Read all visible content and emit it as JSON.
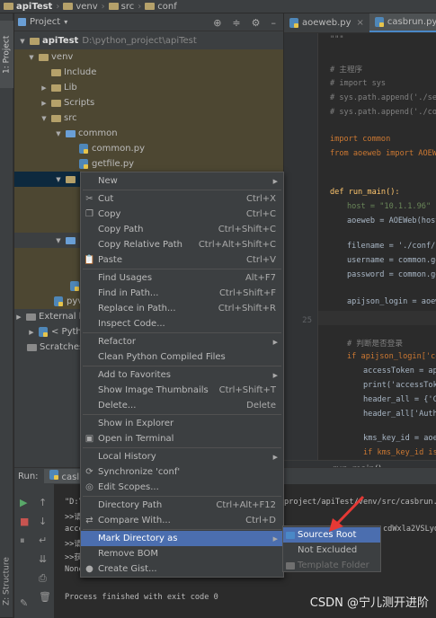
{
  "breadcrumb": [
    "apiTest",
    "venv",
    "src",
    "conf"
  ],
  "side_tabs": {
    "project": "1: Project",
    "structure": "Z: Structure"
  },
  "project_panel": {
    "title": "Project",
    "root": {
      "name": "apiTest",
      "path": "D:\\python_project\\apiTest"
    },
    "tree": [
      {
        "label": "venv",
        "level": 1,
        "expanded": true,
        "type": "folder"
      },
      {
        "label": "Include",
        "level": 2,
        "type": "folder"
      },
      {
        "label": "Lib",
        "level": 2,
        "collapsed": true,
        "type": "folder"
      },
      {
        "label": "Scripts",
        "level": 2,
        "collapsed": true,
        "type": "folder"
      },
      {
        "label": "src",
        "level": 2,
        "expanded": true,
        "type": "folder"
      },
      {
        "label": "common",
        "level": 3,
        "expanded": true,
        "type": "folder-blue"
      },
      {
        "label": "common.py",
        "level": 4,
        "type": "py"
      },
      {
        "label": "getfile.py",
        "level": 4,
        "type": "py"
      }
    ],
    "partial_rows": [
      "pyv",
      "External l",
      "< Pyth",
      "Scratches"
    ]
  },
  "editor": {
    "tabs": [
      "aoeweb.py",
      "casbrun.py"
    ],
    "line_numbers": [
      "25"
    ],
    "lines": [
      {
        "t": "\"\"\"",
        "c": "st"
      },
      {
        "t": "# 主程序",
        "c": "cm"
      },
      {
        "t": "# import sys",
        "c": "cm"
      },
      {
        "t": "# sys.path.append('./serv",
        "c": "cm"
      },
      {
        "t": "# sys.path.append('./com",
        "c": "cm"
      },
      {
        "t": "import common",
        "c": "kw"
      },
      {
        "t": "from aoeweb import AOEWeb",
        "c": "kw"
      },
      {
        "t": "def run_main():",
        "c": "kw"
      },
      {
        "t": "host = \"10.1.1.96\"",
        "c": "st"
      },
      {
        "t": "aoeweb = AOEWeb(host)",
        "c": ""
      },
      {
        "t": "filename = './conf/jo",
        "c": ""
      },
      {
        "t": "username = common.get",
        "c": ""
      },
      {
        "t": "password = common.get",
        "c": ""
      },
      {
        "t": "apijson_login = aoewe",
        "c": ""
      },
      {
        "t": "# 判断是否登录",
        "c": "cm"
      },
      {
        "t": "if apijson_login['co",
        "c": "kw"
      },
      {
        "t": "accessToken = api",
        "c": ""
      },
      {
        "t": "print('accessToke",
        "c": ""
      },
      {
        "t": "header_all = {'Co",
        "c": ""
      },
      {
        "t": "header_all['Autho",
        "c": ""
      },
      {
        "t": "kms_key_id = aoew",
        "c": ""
      },
      {
        "t": "if kms_key_id is",
        "c": "kw"
      }
    ],
    "footer": "run_main()"
  },
  "run_panel": {
    "label": "Run:",
    "tab": "casl",
    "output": [
      "\"D:\\",
      "project/apiTest/venv/src/casbrun.py",
      ">>请",
      "acce",
      "cdWxla2VSLyoq",
      ">>请",
      ">>获",
      "None",
      "Process finished with exit code 0"
    ]
  },
  "context_menu": {
    "items": [
      {
        "icon": "",
        "label": "New",
        "shortcut": "",
        "sub": true
      },
      {
        "sep": true
      },
      {
        "icon": "cut-icon",
        "label": "Cut",
        "shortcut": "Ctrl+X"
      },
      {
        "icon": "copy-icon",
        "label": "Copy",
        "shortcut": "Ctrl+C"
      },
      {
        "icon": "",
        "label": "Copy Path",
        "shortcut": "Ctrl+Shift+C"
      },
      {
        "icon": "",
        "label": "Copy Relative Path",
        "shortcut": "Ctrl+Alt+Shift+C"
      },
      {
        "icon": "paste-icon",
        "label": "Paste",
        "shortcut": "Ctrl+V"
      },
      {
        "sep": true
      },
      {
        "icon": "",
        "label": "Find Usages",
        "shortcut": "Alt+F7"
      },
      {
        "icon": "",
        "label": "Find in Path...",
        "shortcut": "Ctrl+Shift+F"
      },
      {
        "icon": "",
        "label": "Replace in Path...",
        "shortcut": "Ctrl+Shift+R"
      },
      {
        "icon": "",
        "label": "Inspect Code...",
        "shortcut": ""
      },
      {
        "sep": true
      },
      {
        "icon": "",
        "label": "Refactor",
        "shortcut": "",
        "sub": true
      },
      {
        "icon": "",
        "label": "Clean Python Compiled Files",
        "shortcut": ""
      },
      {
        "sep": true
      },
      {
        "icon": "",
        "label": "Add to Favorites",
        "shortcut": "",
        "sub": true
      },
      {
        "icon": "",
        "label": "Show Image Thumbnails",
        "shortcut": "Ctrl+Shift+T"
      },
      {
        "icon": "",
        "label": "Delete...",
        "shortcut": "Delete"
      },
      {
        "sep": true
      },
      {
        "icon": "",
        "label": "Show in Explorer",
        "shortcut": ""
      },
      {
        "icon": "terminal-icon",
        "label": "Open in Terminal",
        "shortcut": ""
      },
      {
        "sep": true
      },
      {
        "icon": "",
        "label": "Local History",
        "shortcut": "",
        "sub": true
      },
      {
        "icon": "sync-icon",
        "label": "Synchronize 'conf'",
        "shortcut": ""
      },
      {
        "icon": "scopes-icon",
        "label": "Edit Scopes...",
        "shortcut": ""
      },
      {
        "sep": true
      },
      {
        "icon": "",
        "label": "Directory Path",
        "shortcut": "Ctrl+Alt+F12"
      },
      {
        "icon": "compare-icon",
        "label": "Compare With...",
        "shortcut": "Ctrl+D"
      },
      {
        "sep": true
      },
      {
        "icon": "",
        "label": "Mark Directory as",
        "shortcut": "",
        "sub": true,
        "hl": true
      },
      {
        "icon": "",
        "label": "Remove BOM",
        "shortcut": ""
      },
      {
        "icon": "github-icon",
        "label": "Create Gist...",
        "shortcut": ""
      }
    ]
  },
  "submenu": {
    "items": [
      {
        "label": "Sources Root",
        "color": "#4a88c7",
        "hl": true
      },
      {
        "label": "Not Excluded",
        "color": ""
      },
      {
        "label": "Template Folder",
        "color": "#6f6f6f",
        "disabled": true
      }
    ]
  },
  "watermark": "CSDN @宁儿测开进阶",
  "colors": {
    "accent": "#4b6eaf",
    "folder": "#b5a16a",
    "source_folder": "#6a9fd6",
    "arrow": "#e53935"
  }
}
